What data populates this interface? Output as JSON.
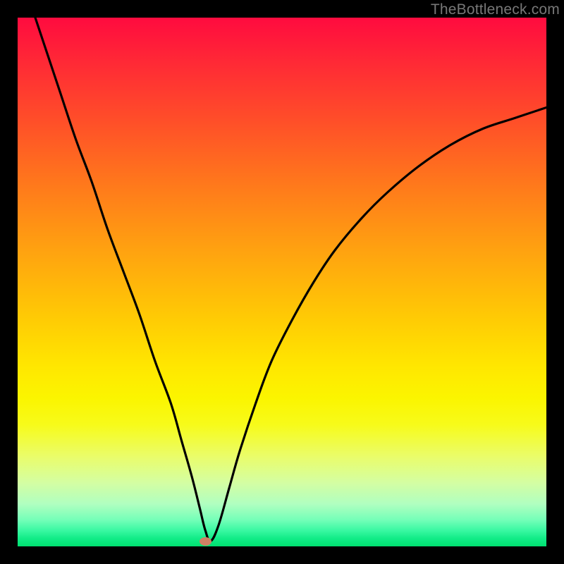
{
  "watermark": "TheBottleneck.com",
  "colors": {
    "black": "#000000",
    "curve": "#000000",
    "marker": "#cf8164",
    "gradient_top": "#ff0b3f",
    "gradient_bottom": "#00e070"
  },
  "chart_data": {
    "type": "line",
    "title": "",
    "xlabel": "",
    "ylabel": "",
    "xlim": [
      0,
      100
    ],
    "ylim": [
      0,
      100
    ],
    "grid": false,
    "legend": false,
    "note": "Plot shown with no visible axis ticks or numeric labels; y encodes bottleneck severity (top = worst/red, bottom = best/green). Values are estimated from curve geometry.",
    "series": [
      {
        "name": "bottleneck-curve",
        "x": [
          3,
          5,
          8,
          11,
          14,
          17,
          20,
          23,
          26,
          29,
          31,
          33,
          34.5,
          35.5,
          36.5,
          38,
          40,
          42,
          45,
          48,
          52,
          56,
          60,
          65,
          70,
          76,
          82,
          88,
          94,
          100
        ],
        "y": [
          101,
          95,
          86,
          77,
          69,
          60,
          52,
          44,
          35,
          27,
          20,
          13,
          7,
          3,
          1,
          4,
          11,
          18,
          27,
          35,
          43,
          50,
          56,
          62,
          67,
          72,
          76,
          79,
          81,
          83
        ]
      }
    ],
    "marker": {
      "x": 35.5,
      "y": 1
    }
  }
}
